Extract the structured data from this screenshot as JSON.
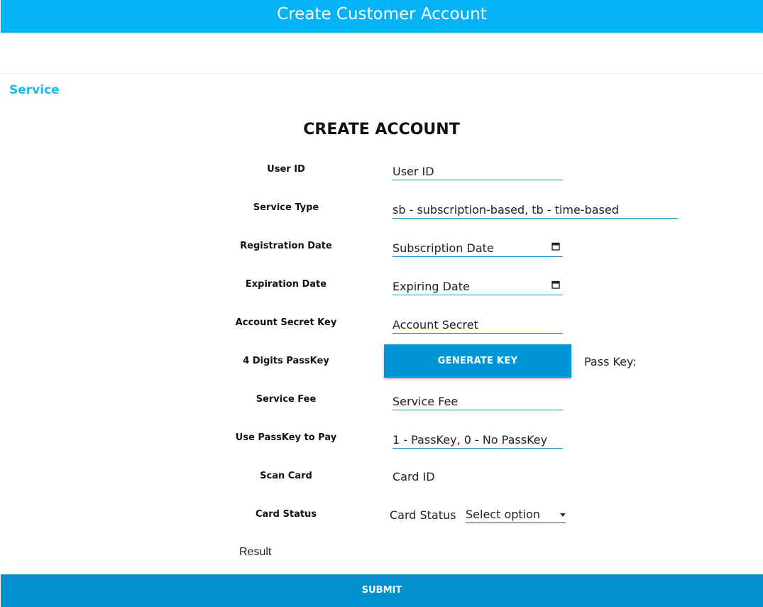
{
  "header": {
    "title": "Create Customer Account"
  },
  "nav": {
    "service_link": "Service"
  },
  "form": {
    "title": "CREATE ACCOUNT",
    "user_id": {
      "label": "User ID",
      "placeholder": "User ID"
    },
    "service_type": {
      "label": "Service Type",
      "placeholder": "sb - subscription-based, tb - time-based"
    },
    "registration_date": {
      "label": "Registration Date",
      "placeholder": "Subscription Date",
      "icon": "calendar-icon"
    },
    "expiration_date": {
      "label": "Expiration Date",
      "placeholder": "Expiring Date",
      "icon": "calendar-icon"
    },
    "account_secret": {
      "label": "Account Secret Key",
      "placeholder": "Account Secret"
    },
    "passkey": {
      "label": "4 Digits PassKey",
      "button": "GENERATE KEY",
      "result_label": "Pass Key:"
    },
    "service_fee": {
      "label": "Service Fee",
      "placeholder": "Service Fee"
    },
    "use_passkey": {
      "label": "Use PassKey to Pay",
      "placeholder": "1 - PassKey, 0 - No PassKey"
    },
    "scan_card": {
      "label": "Scan Card",
      "value": "Card ID"
    },
    "card_status": {
      "label": "Card Status",
      "inner_label": "Card Status",
      "selected": "Select option",
      "icon": "chevron-down-icon"
    },
    "result": "Result",
    "submit": "SUBMIT"
  },
  "colors": {
    "header": "#03b3f5",
    "button": "#0096d6",
    "link": "#1fb8ec",
    "underline": "#1a95c9"
  }
}
